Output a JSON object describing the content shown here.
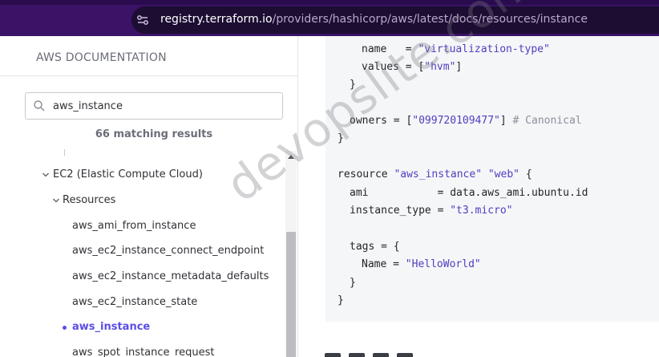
{
  "browser": {
    "url_domain": "registry.terraform.io",
    "url_path": "/providers/hashicorp/aws/latest/docs/resources/instance",
    "site_icon": "site-settings-icon"
  },
  "sidebar": {
    "title": "AWS DOCUMENTATION",
    "search": {
      "value": "aws_instance",
      "icon": "search-icon"
    },
    "match_count": "66 matching results",
    "tree": [
      {
        "label": "EC2 (Elastic Compute Cloud)",
        "expanded": true
      },
      {
        "label": "Resources",
        "expanded": true
      },
      {
        "label": "aws_ami_from_instance"
      },
      {
        "label": "aws_ec2_instance_connect_endpoint"
      },
      {
        "label": "aws_ec2_instance_metadata_defaults"
      },
      {
        "label": "aws_ec2_instance_state"
      },
      {
        "label": "aws_instance",
        "active": true
      },
      {
        "label": "aws_spot_instance_request"
      }
    ]
  },
  "code": {
    "l1_key": "name",
    "l1_eq": "=",
    "l1_val": "\"virtualization-type\"",
    "l2_key": "values",
    "l2_eq": "=",
    "l2_open": "[",
    "l2_val": "\"hvm\"",
    "l2_close": "]",
    "l3": "}",
    "l4_key": "owners",
    "l4_eq": "=",
    "l4_open": "[",
    "l4_val": "\"099720109477\"",
    "l4_close": "]",
    "l4_cmt": "# Canonical",
    "l5": "}",
    "l6_kw": "resource",
    "l6_t": "\"aws_instance\"",
    "l6_n": "\"web\"",
    "l6_brace": "{",
    "l7_key": "ami",
    "l7_eq": "=",
    "l7_val": "data.aws_ami.ubuntu.id",
    "l8_key": "instance_type",
    "l8_eq": "=",
    "l8_val": "\"t3.micro\"",
    "l9_key": "tags",
    "l9_eq": "=",
    "l9_brace": "{",
    "l10_key": "Name",
    "l10_eq": "=",
    "l10_val": "\"HelloWorld\"",
    "l11": "}",
    "l12": "}"
  },
  "watermark": "devopslite.com"
}
